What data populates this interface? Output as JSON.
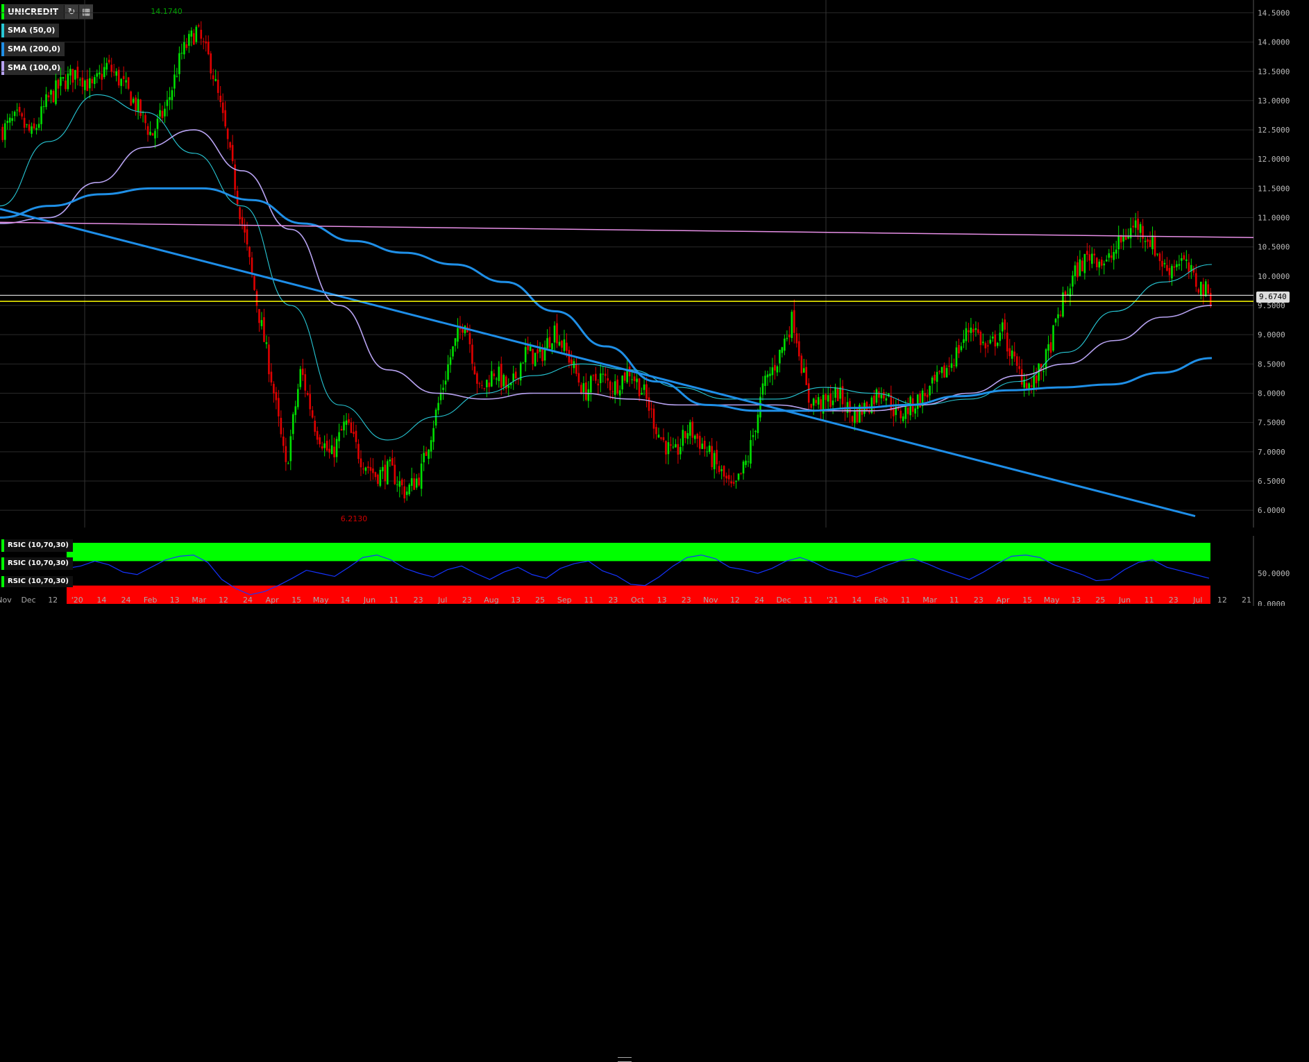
{
  "toolbar": {
    "symbol": "UNICREDIT",
    "refresh_icon": "refresh-icon",
    "calendar_icon": "calendar-icon"
  },
  "indicators": [
    {
      "label": "SMA (50,0)",
      "color": "#27c8d6"
    },
    {
      "label": "SMA (200,0)",
      "color": "#1f8fe6"
    },
    {
      "label": "SMA (100,0)",
      "color": "#b8a3f2"
    }
  ],
  "rsi_labels": [
    "RSIC (10,70,30)",
    "RSIC (10,70,30)",
    "RSIC (10,70,30)"
  ],
  "price_tag": "9.6740",
  "colors": {
    "up": "#00e000",
    "down": "#e00000",
    "sma50": "#27c8d6",
    "sma100": "#b8a3f2",
    "sma200": "#1f8fe6",
    "trendline": "#1e8ee8",
    "resistance": "#e890e8",
    "horizontal": "#ffffff",
    "support": "#ffff00",
    "rsi_high": "#00ff00",
    "rsi_low": "#ff0000",
    "rsi_line": "#1533ff"
  },
  "chart_data": {
    "type": "candlestick",
    "symbol": "UNICREDIT",
    "ylim": [
      5.8,
      14.6
    ],
    "y_ticks": [
      "6.0000",
      "6.5000",
      "7.0000",
      "7.5000",
      "8.0000",
      "8.5000",
      "9.0000",
      "9.5000",
      "10.0000",
      "10.5000",
      "11.0000",
      "11.5000",
      "12.0000",
      "12.5000",
      "13.0000",
      "13.5000",
      "14.0000",
      "14.5000"
    ],
    "x_labels": [
      "Nov",
      "Dec",
      "12",
      "'20",
      "14",
      "24",
      "Feb",
      "13",
      "Mar",
      "12",
      "24",
      "Apr",
      "15",
      "May",
      "14",
      "Jun",
      "11",
      "23",
      "Jul",
      "23",
      "Aug",
      "13",
      "25",
      "Sep",
      "11",
      "23",
      "Oct",
      "13",
      "23",
      "Nov",
      "12",
      "24",
      "Dec",
      "11",
      "'21",
      "14",
      "Feb",
      "11",
      "Mar",
      "11",
      "23",
      "Apr",
      "15",
      "May",
      "13",
      "25",
      "Jun",
      "11",
      "23",
      "Jul",
      "12",
      "21"
    ],
    "annotations": {
      "max": "14.1740",
      "min": "6.2130"
    },
    "last_price": 9.674,
    "price_path": [
      12.5,
      12.7,
      12.4,
      13.0,
      13.3,
      13.5,
      13.2,
      13.6,
      13.3,
      12.9,
      12.4,
      12.9,
      13.8,
      14.2,
      13.6,
      12.4,
      11.0,
      9.6,
      8.3,
      6.7,
      8.4,
      7.4,
      6.9,
      7.5,
      6.9,
      6.6,
      6.7,
      6.3,
      6.6,
      7.6,
      8.6,
      9.3,
      8.0,
      8.4,
      8.0,
      8.7,
      8.6,
      9.1,
      8.6,
      8.0,
      8.3,
      8.1,
      8.4,
      8.0,
      7.3,
      6.9,
      7.4,
      7.1,
      6.7,
      6.3,
      6.9,
      8.1,
      8.6,
      9.3,
      7.9,
      7.8,
      8.0,
      7.6,
      7.8,
      8.1,
      7.6,
      7.8,
      8.0,
      8.3,
      8.7,
      9.2,
      8.7,
      9.1,
      8.4,
      8.1,
      8.6,
      9.5,
      10.1,
      10.4,
      10.2,
      10.6,
      10.9,
      10.6,
      10.1,
      10.3,
      9.9,
      9.67
    ],
    "trendlines": [
      {
        "name": "Descending trendline",
        "from": [
          0,
          11.15
        ],
        "to": [
          1,
          5.7
        ]
      },
      {
        "name": "Resistance line",
        "from": [
          0,
          10.92
        ],
        "to": [
          1,
          10.66
        ]
      },
      {
        "name": "Horizontal level",
        "value": 9.674
      },
      {
        "name": "Support level",
        "value": 9.57
      }
    ],
    "series": [
      {
        "name": "SMA (50,0)",
        "values": [
          11.2,
          12.3,
          13.1,
          12.8,
          12.1,
          11.2,
          9.5,
          7.8,
          7.2,
          7.6,
          8.0,
          8.3,
          8.5,
          8.4,
          8.1,
          7.9,
          7.9,
          8.1,
          8.0,
          7.8,
          7.9,
          8.2,
          8.7,
          9.4,
          9.9,
          10.2
        ]
      },
      {
        "name": "SMA (100,0)",
        "values": [
          10.9,
          11.0,
          11.6,
          12.2,
          12.5,
          11.8,
          10.8,
          9.5,
          8.4,
          8.0,
          7.9,
          8.0,
          8.0,
          7.9,
          7.8,
          7.8,
          7.8,
          7.7,
          7.7,
          7.8,
          8.0,
          8.3,
          8.5,
          8.9,
          9.3,
          9.5
        ]
      },
      {
        "name": "SMA (200,0)",
        "values": [
          11.0,
          11.2,
          11.4,
          11.5,
          11.5,
          11.3,
          10.9,
          10.6,
          10.4,
          10.2,
          9.9,
          9.4,
          8.8,
          8.2,
          7.8,
          7.7,
          7.7,
          7.75,
          7.8,
          7.95,
          8.05,
          8.1,
          8.15,
          8.35,
          8.6
        ]
      }
    ],
    "rsi": {
      "label": "RSIC (10,70,30)",
      "overbought": 70,
      "oversold": 30,
      "y_ticks": [
        "0.0000",
        "50.0000"
      ],
      "values": [
        58,
        62,
        70,
        64,
        52,
        48,
        60,
        72,
        78,
        80,
        68,
        40,
        25,
        15,
        20,
        30,
        42,
        55,
        50,
        45,
        60,
        76,
        80,
        72,
        58,
        50,
        44,
        56,
        62,
        50,
        40,
        52,
        60,
        48,
        42,
        58,
        66,
        70,
        54,
        46,
        32,
        30,
        44,
        62,
        76,
        80,
        74,
        60,
        56,
        50,
        58,
        70,
        76,
        68,
        56,
        50,
        44,
        52,
        62,
        70,
        74,
        66,
        56,
        48,
        40,
        52,
        66,
        78,
        80,
        76,
        64,
        56,
        48,
        38,
        40,
        56,
        68,
        72,
        60,
        54,
        48,
        42
      ]
    }
  }
}
